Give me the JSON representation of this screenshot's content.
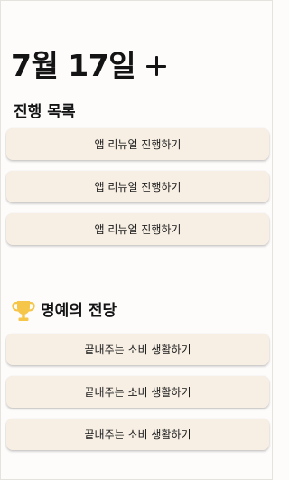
{
  "header": {
    "date": "7월 17일",
    "add_icon": "plus-icon"
  },
  "progress": {
    "title": "진행 목록",
    "items": [
      {
        "label": "앱 리뉴얼 진행하기"
      },
      {
        "label": "앱 리뉴얼 진행하기"
      },
      {
        "label": "앱 리뉴얼 진행하기"
      }
    ]
  },
  "hall_of_fame": {
    "title": "명예의 전당",
    "icon": "trophy-icon",
    "items": [
      {
        "label": "끝내주는 소비 생활하기"
      },
      {
        "label": "끝내주는 소비 생활하기"
      },
      {
        "label": "끝내주는 소비 생활하기"
      }
    ]
  },
  "colors": {
    "card_background": "#f7efe4",
    "trophy": "#f5c64a",
    "text": "#141414"
  }
}
